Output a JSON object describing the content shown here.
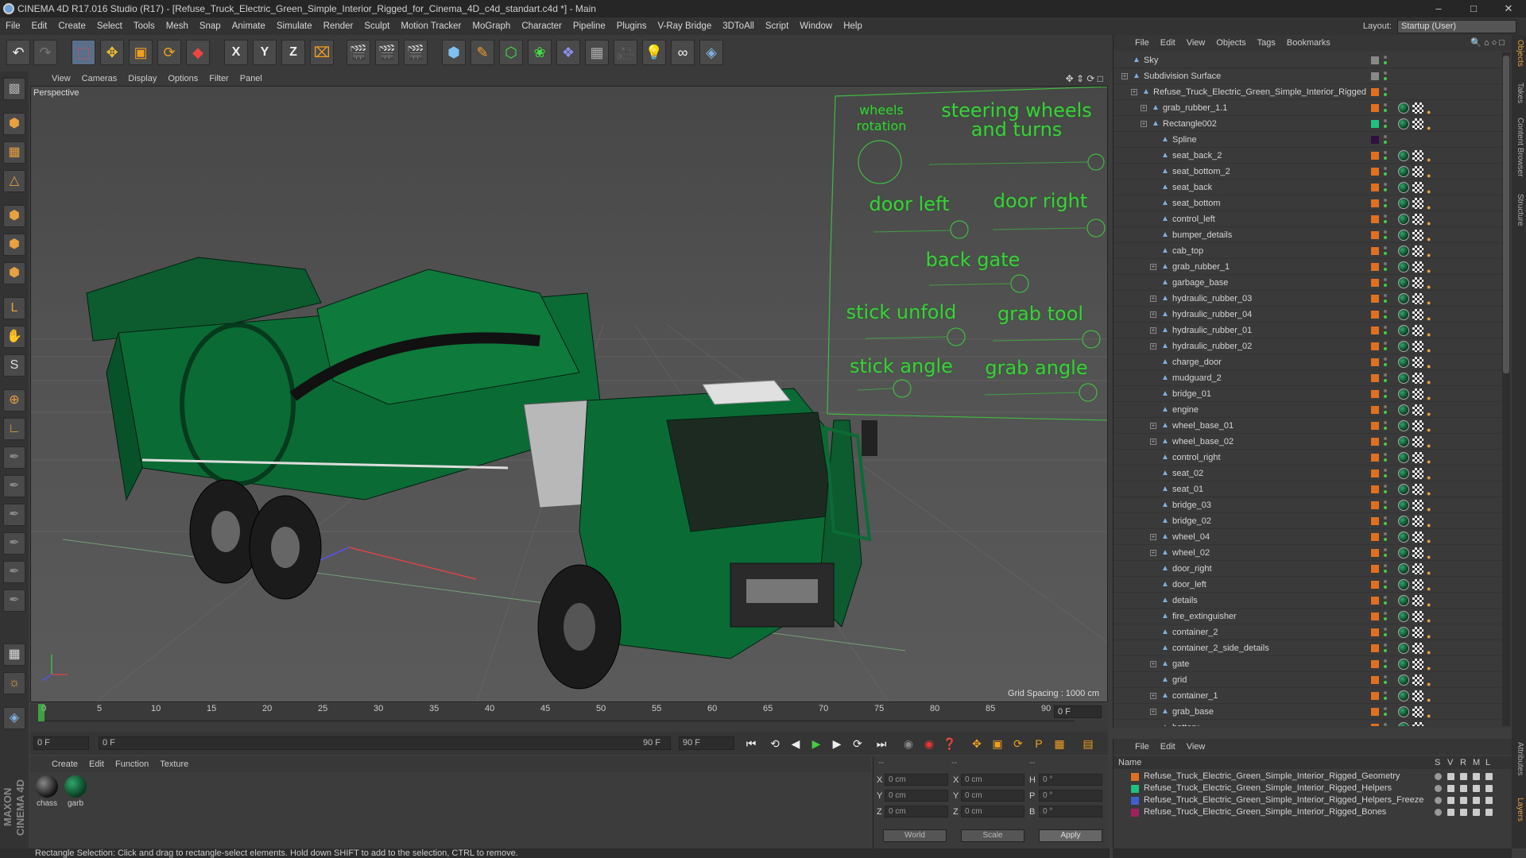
{
  "window": {
    "title": "CINEMA 4D R17.016 Studio (R17) - [Refuse_Truck_Electric_Green_Simple_Interior_Rigged_for_Cinema_4D_c4d_standart.c4d *] - Main"
  },
  "menu": [
    "File",
    "Edit",
    "Create",
    "Select",
    "Tools",
    "Mesh",
    "Snap",
    "Animate",
    "Simulate",
    "Render",
    "Sculpt",
    "Motion Tracker",
    "MoGraph",
    "Character",
    "Pipeline",
    "Plugins",
    "V-Ray Bridge",
    "3DToAll",
    "Script",
    "Window",
    "Help"
  ],
  "layout": {
    "label": "Layout:",
    "value": "Startup (User)"
  },
  "viewport": {
    "menu": [
      "View",
      "Cameras",
      "Display",
      "Options",
      "Filter",
      "Panel"
    ],
    "label": "Perspective",
    "grid_spacing": "Grid Spacing : 1000 cm",
    "hud": {
      "wheels_rotation": "wheels rotation",
      "steering": "steering wheels and turns",
      "door_left": "door left",
      "door_right": "door right",
      "back_gate": "back gate",
      "stick_unfold": "stick unfold",
      "grab_tool": "grab tool",
      "stick_angle": "stick angle",
      "grab_angle": "grab angle"
    }
  },
  "timeline": {
    "ticks": [
      "0",
      "5",
      "10",
      "15",
      "20",
      "25",
      "30",
      "35",
      "40",
      "45",
      "50",
      "55",
      "60",
      "65",
      "70",
      "75",
      "80",
      "85",
      "90"
    ],
    "end_frame": "0 F",
    "start_field": "0 F",
    "range_start": "0 F",
    "range_end": "90 F",
    "end_field": "90 F"
  },
  "materials": {
    "menu": [
      "Create",
      "Edit",
      "Function",
      "Texture"
    ],
    "items": [
      "chass",
      "garb"
    ]
  },
  "coords": {
    "x_label": "X",
    "y_label": "Y",
    "z_label": "Z",
    "h_label": "H",
    "p_label": "P",
    "b_label": "B",
    "pos_x": "0 cm",
    "pos_y": "0 cm",
    "pos_z": "0 cm",
    "size_x": "0 cm",
    "size_y": "0 cm",
    "size_z": "0 cm",
    "rot_h": "0 °",
    "rot_p": "0 °",
    "rot_b": "0 °",
    "mode": "World",
    "scale": "Scale",
    "apply": "Apply",
    "top_left": "--",
    "top_mid": "--",
    "top_right": "--"
  },
  "status": "Rectangle Selection: Click and drag to rectangle-select elements. Hold down SHIFT to add to the selection, CTRL to remove.",
  "objects": {
    "menu": [
      "File",
      "Edit",
      "View",
      "Objects",
      "Tags",
      "Bookmarks"
    ],
    "rows": [
      {
        "name": "Sky",
        "indent": 0,
        "exp": false,
        "color": "#888888"
      },
      {
        "name": "Subdivision Surface",
        "indent": 0,
        "exp": true,
        "color": "#888888"
      },
      {
        "name": "Refuse_Truck_Electric_Green_Simple_Interior_Rigged",
        "indent": 1,
        "exp": true,
        "color": "#e07020"
      },
      {
        "name": "grab_rubber_1.1",
        "indent": 2,
        "exp": true,
        "color": "#e07020"
      },
      {
        "name": "Rectangle002",
        "indent": 2,
        "exp": true,
        "color": "#20c080"
      },
      {
        "name": "Spline",
        "indent": 3,
        "exp": false,
        "color": "#301040"
      },
      {
        "name": "seat_back_2",
        "indent": 3,
        "exp": false,
        "color": "#e07020"
      },
      {
        "name": "seat_bottom_2",
        "indent": 3,
        "exp": false,
        "color": "#e07020"
      },
      {
        "name": "seat_back",
        "indent": 3,
        "exp": false,
        "color": "#e07020"
      },
      {
        "name": "seat_bottom",
        "indent": 3,
        "exp": false,
        "color": "#e07020"
      },
      {
        "name": "control_left",
        "indent": 3,
        "exp": false,
        "color": "#e07020"
      },
      {
        "name": "bumper_details",
        "indent": 3,
        "exp": false,
        "color": "#e07020"
      },
      {
        "name": "cab_top",
        "indent": 3,
        "exp": false,
        "color": "#e07020"
      },
      {
        "name": "grab_rubber_1",
        "indent": 3,
        "exp": true,
        "color": "#e07020"
      },
      {
        "name": "garbage_base",
        "indent": 3,
        "exp": false,
        "color": "#e07020"
      },
      {
        "name": "hydraulic_rubber_03",
        "indent": 3,
        "exp": true,
        "color": "#e07020"
      },
      {
        "name": "hydraulic_rubber_04",
        "indent": 3,
        "exp": true,
        "color": "#e07020"
      },
      {
        "name": "hydraulic_rubber_01",
        "indent": 3,
        "exp": true,
        "color": "#e07020"
      },
      {
        "name": "hydraulic_rubber_02",
        "indent": 3,
        "exp": true,
        "color": "#e07020"
      },
      {
        "name": "charge_door",
        "indent": 3,
        "exp": false,
        "color": "#e07020"
      },
      {
        "name": "mudguard_2",
        "indent": 3,
        "exp": false,
        "color": "#e07020"
      },
      {
        "name": "bridge_01",
        "indent": 3,
        "exp": false,
        "color": "#e07020"
      },
      {
        "name": "engine",
        "indent": 3,
        "exp": false,
        "color": "#e07020"
      },
      {
        "name": "wheel_base_01",
        "indent": 3,
        "exp": true,
        "color": "#e07020"
      },
      {
        "name": "wheel_base_02",
        "indent": 3,
        "exp": true,
        "color": "#e07020"
      },
      {
        "name": "control_right",
        "indent": 3,
        "exp": false,
        "color": "#e07020"
      },
      {
        "name": "seat_02",
        "indent": 3,
        "exp": false,
        "color": "#e07020"
      },
      {
        "name": "seat_01",
        "indent": 3,
        "exp": false,
        "color": "#e07020"
      },
      {
        "name": "bridge_03",
        "indent": 3,
        "exp": false,
        "color": "#e07020"
      },
      {
        "name": "bridge_02",
        "indent": 3,
        "exp": false,
        "color": "#e07020"
      },
      {
        "name": "wheel_04",
        "indent": 3,
        "exp": true,
        "color": "#e07020"
      },
      {
        "name": "wheel_02",
        "indent": 3,
        "exp": true,
        "color": "#e07020"
      },
      {
        "name": "door_right",
        "indent": 3,
        "exp": false,
        "color": "#e07020"
      },
      {
        "name": "door_left",
        "indent": 3,
        "exp": false,
        "color": "#e07020"
      },
      {
        "name": "details",
        "indent": 3,
        "exp": false,
        "color": "#e07020"
      },
      {
        "name": "fire_extinguisher",
        "indent": 3,
        "exp": false,
        "color": "#e07020"
      },
      {
        "name": "container_2",
        "indent": 3,
        "exp": false,
        "color": "#e07020"
      },
      {
        "name": "container_2_side_details",
        "indent": 3,
        "exp": false,
        "color": "#e07020"
      },
      {
        "name": "gate",
        "indent": 3,
        "exp": true,
        "color": "#e07020"
      },
      {
        "name": "grid",
        "indent": 3,
        "exp": false,
        "color": "#e07020"
      },
      {
        "name": "container_1",
        "indent": 3,
        "exp": true,
        "color": "#e07020"
      },
      {
        "name": "grab_base",
        "indent": 3,
        "exp": true,
        "color": "#e07020"
      },
      {
        "name": "battery",
        "indent": 3,
        "exp": false,
        "color": "#e07020"
      }
    ]
  },
  "layers": {
    "menu": [
      "File",
      "Edit",
      "View"
    ],
    "header": {
      "name": "Name",
      "s": "S",
      "v": "V",
      "r": "R",
      "m": "M",
      "l": "L"
    },
    "rows": [
      {
        "name": "Refuse_Truck_Electric_Green_Simple_Interior_Rigged_Geometry",
        "color": "#e07020"
      },
      {
        "name": "Refuse_Truck_Electric_Green_Simple_Interior_Rigged_Helpers",
        "color": "#20c080"
      },
      {
        "name": "Refuse_Truck_Electric_Green_Simple_Interior_Rigged_Helpers_Freeze",
        "color": "#4060d0"
      },
      {
        "name": "Refuse_Truck_Electric_Green_Simple_Interior_Rigged_Bones",
        "color": "#a02060"
      }
    ]
  },
  "right_tabs": [
    "Objects",
    "Takes",
    "Content Browser",
    "Structure",
    "Attributes",
    "Layers"
  ],
  "colors": {
    "hud_green": "#3fcc3f",
    "truck_green": "#0b6b35",
    "accent_orange": "#e07020"
  }
}
